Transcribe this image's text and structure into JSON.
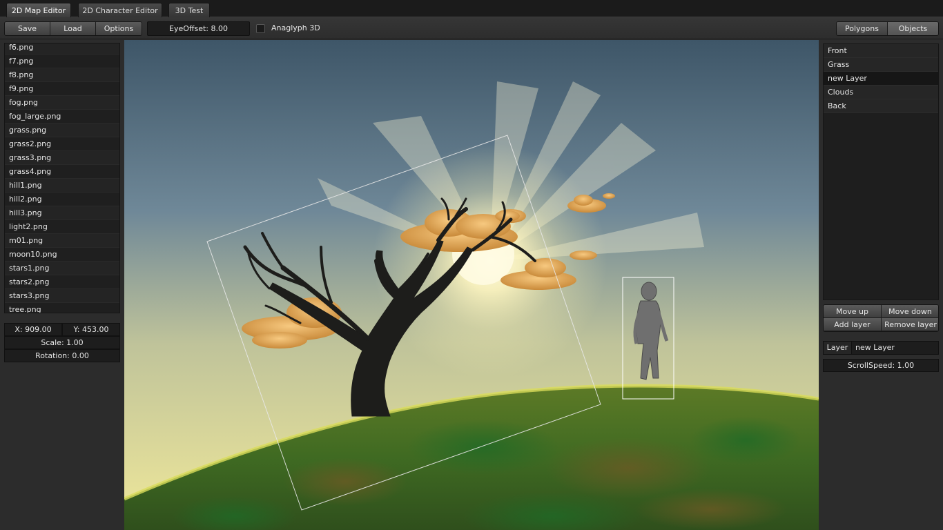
{
  "tabs": [
    {
      "label": "2D Map Editor",
      "active": true
    },
    {
      "label": "2D Character Editor",
      "active": false
    },
    {
      "label": "3D Test",
      "active": false
    }
  ],
  "toolbar": {
    "save": "Save",
    "load": "Load",
    "options": "Options",
    "eye_offset": "EyeOffset: 8.00",
    "anaglyph": "Anaglyph 3D",
    "polygons": "Polygons",
    "objects": "Objects"
  },
  "files": [
    "f6.png",
    "f7.png",
    "f8.png",
    "f9.png",
    "fog.png",
    "fog_large.png",
    "grass.png",
    "grass2.png",
    "grass3.png",
    "grass4.png",
    "hill1.png",
    "hill2.png",
    "hill3.png",
    "light2.png",
    "m01.png",
    "moon10.png",
    "stars1.png",
    "stars2.png",
    "stars3.png",
    "tree.png"
  ],
  "transform": {
    "x": "X: 909.00",
    "y": "Y: 453.00",
    "scale": "Scale: 1.00",
    "rotation": "Rotation: 0.00"
  },
  "layers": [
    {
      "label": "Front",
      "selected": false
    },
    {
      "label": "Grass",
      "selected": false
    },
    {
      "label": "new Layer",
      "selected": true
    },
    {
      "label": "Clouds",
      "selected": false
    },
    {
      "label": "Back",
      "selected": false
    }
  ],
  "layer_buttons": {
    "move_up": "Move up",
    "move_down": "Move down",
    "add_layer": "Add layer",
    "remove_layer": "Remove layer"
  },
  "layer_props": {
    "label": "Layer",
    "name": "new Layer",
    "scroll_speed": "ScrollSpeed: 1.00"
  },
  "colors": {
    "sky_top": "#3e5668",
    "sky_bottom": "#e6e08e",
    "hill": "#4b6a22",
    "sun": "#fff9d0"
  }
}
